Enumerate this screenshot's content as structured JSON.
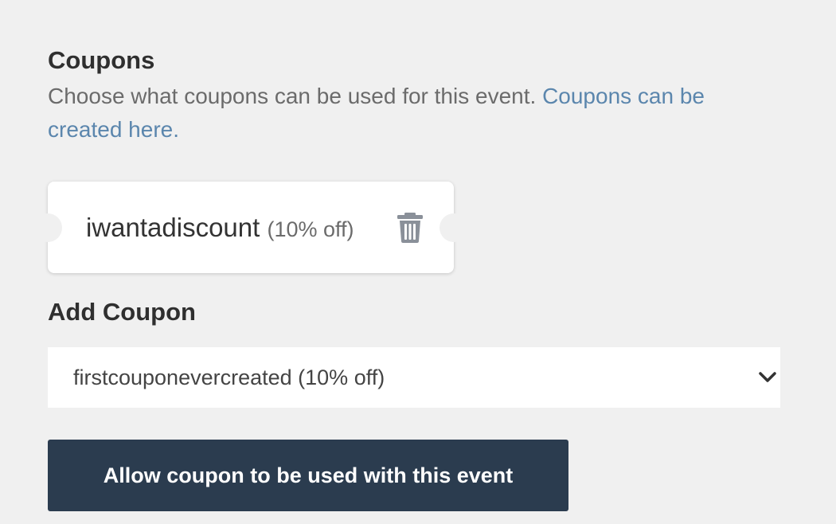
{
  "coupons": {
    "title": "Coupons",
    "description": "Choose what coupons can be used for this event.",
    "create_link": "Coupons can be created here."
  },
  "applied_coupon": {
    "code": "iwantadiscount",
    "discount": "(10% off)",
    "delete_icon": "trash-icon"
  },
  "add_coupon": {
    "title": "Add Coupon",
    "selected": "firstcouponevercreated (10% off)",
    "dropdown_icon": "chevron-down-icon"
  },
  "actions": {
    "allow_label": "Allow coupon to be used with this event"
  },
  "colors": {
    "background": "#f0f0f0",
    "link": "#5b86ad",
    "button": "#2b3c4f",
    "icon": "#8a9099"
  }
}
